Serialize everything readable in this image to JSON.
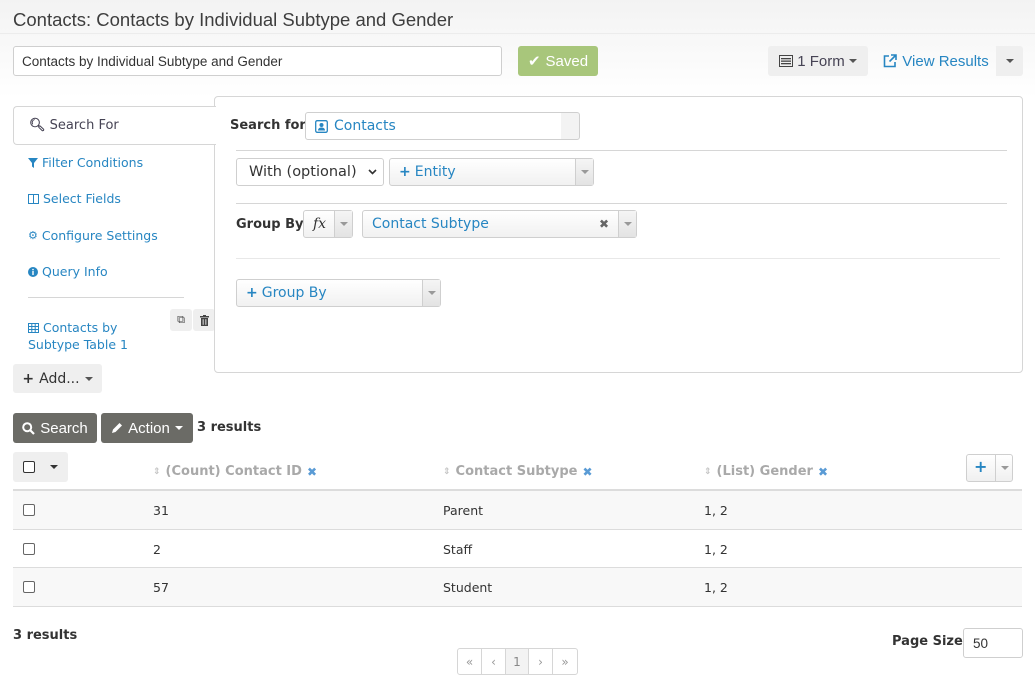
{
  "page": {
    "title": "Contacts: Contacts by Individual Subtype and Gender",
    "search_label_value": "Contacts by Individual Subtype and Gender"
  },
  "toolbar": {
    "saved_label": "Saved",
    "forms_label": "1 Form",
    "view_results_label": "View Results"
  },
  "sidebar": {
    "tabs": [
      {
        "label": "Search For",
        "icon": "search-icon"
      },
      {
        "label": "Filter Conditions",
        "icon": "filter-icon"
      },
      {
        "label": "Select Fields",
        "icon": "columns-icon"
      },
      {
        "label": "Configure Settings",
        "icon": "cogs-icon"
      },
      {
        "label": "Query Info",
        "icon": "info-icon"
      }
    ],
    "display": {
      "label": "Contacts by Subtype Table 1",
      "icon": "table-icon"
    },
    "add_label": "Add..."
  },
  "panel": {
    "search_for_label": "Search for",
    "entity_value": "Contacts",
    "join_select": "With (optional)",
    "join_entity_placeholder": "Entity",
    "group_by_label": "Group By",
    "fx_label": "fx",
    "group_by_value": "Contact Subtype",
    "add_group_by_placeholder": "Group By"
  },
  "results": {
    "search_button": "Search",
    "action_button": "Action",
    "count_text": "3 results",
    "columns": [
      {
        "label": "(Count) Contact ID"
      },
      {
        "label": "Contact Subtype"
      },
      {
        "label": "(List) Gender"
      }
    ],
    "rows": [
      {
        "count": "31",
        "subtype": "Parent",
        "gender": "1, 2"
      },
      {
        "count": "2",
        "subtype": "Staff",
        "gender": "1, 2"
      },
      {
        "count": "57",
        "subtype": "Student",
        "gender": "1, 2"
      }
    ],
    "footer_count": "3 results",
    "page_size_label": "Page Size",
    "page_size_value": "50",
    "pager": {
      "first": "«",
      "prev": "‹",
      "current": "1",
      "next": "›",
      "last": "»"
    }
  },
  "colors": {
    "accent": "#2786c2",
    "saved": "#a8c67b",
    "dark_button": "#6b6b66"
  }
}
